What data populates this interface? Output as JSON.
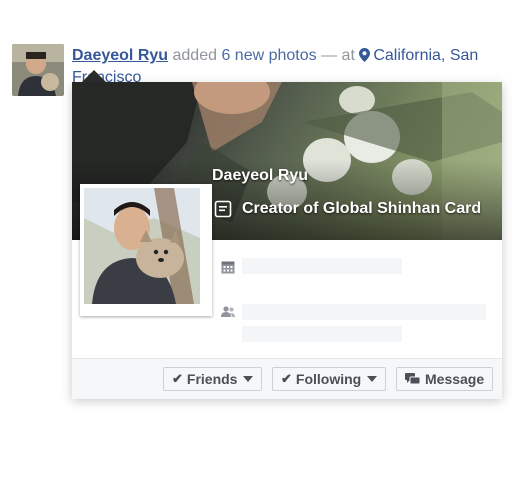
{
  "story": {
    "actor": "Daeyeol Ryu",
    "verb": "added",
    "object": "6 new photos",
    "separator": "— at",
    "location": "California, San Francisco"
  },
  "hovercard": {
    "name": "Daeyeol Ryu",
    "work": "Creator of Global Shinhan Card",
    "icons": {
      "work": "note-icon",
      "calendar": "calendar-icon",
      "friends": "friends-icon"
    },
    "buttons": {
      "friends": "Friends",
      "following": "Following",
      "message": "Message"
    }
  },
  "colors": {
    "link": "#365899",
    "meta": "#90949c",
    "button_text": "#4b4f56",
    "footer_bg": "#f6f7f9"
  }
}
